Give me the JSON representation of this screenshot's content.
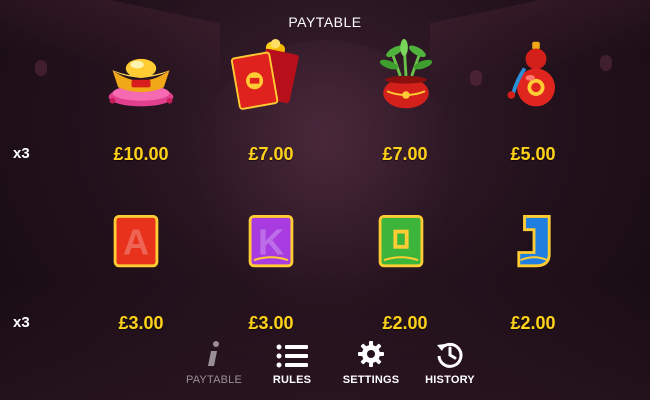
{
  "title": "PAYTABLE",
  "rows": [
    {
      "multiplier": "x3",
      "symbols": [
        {
          "icon": "gold-ingot-icon",
          "prize": "£10.00"
        },
        {
          "icon": "red-envelope-icon",
          "prize": "£7.00"
        },
        {
          "icon": "lucky-bamboo-icon",
          "prize": "£7.00"
        },
        {
          "icon": "gourd-icon",
          "prize": "£5.00"
        }
      ]
    },
    {
      "multiplier": "x3",
      "symbols": [
        {
          "icon": "letter-a-icon",
          "letter": "A",
          "color": "#e8321c",
          "prize": "£3.00"
        },
        {
          "icon": "letter-k-icon",
          "letter": "K",
          "color": "#a93ce0",
          "prize": "£3.00"
        },
        {
          "icon": "letter-q-icon",
          "letter": "Q",
          "color": "#3db53b",
          "prize": "£2.00"
        },
        {
          "icon": "letter-j-icon",
          "letter": "J",
          "color": "#1f7fe0",
          "prize": "£2.00"
        }
      ]
    }
  ],
  "nav": [
    {
      "icon": "info-icon",
      "label": "PAYTABLE",
      "active": true
    },
    {
      "icon": "list-icon",
      "label": "RULES",
      "active": false
    },
    {
      "icon": "gear-icon",
      "label": "SETTINGS",
      "active": false
    },
    {
      "icon": "history-icon",
      "label": "HISTORY",
      "active": false
    }
  ],
  "colors": {
    "prize": "#ffd21a",
    "nav_inactive": "#9a8e96",
    "background": "#24121d"
  }
}
